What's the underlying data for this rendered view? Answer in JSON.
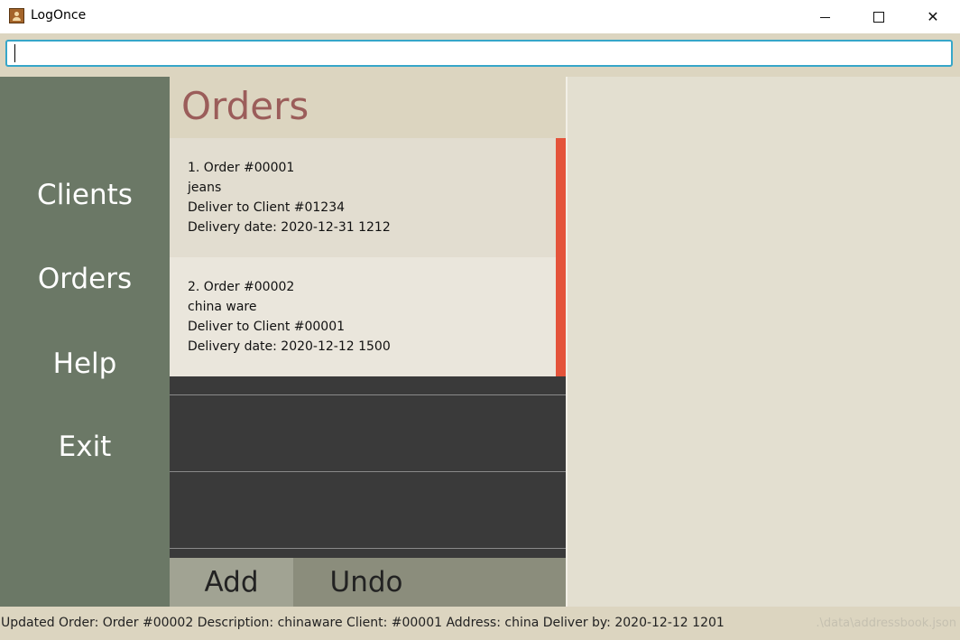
{
  "window": {
    "title": "LogOnce",
    "minimize_icon": "minimize-icon",
    "maximize_icon": "maximize-icon",
    "close_label": "✕"
  },
  "command": {
    "value": "",
    "placeholder": ""
  },
  "sidebar": {
    "items": [
      {
        "label": "Clients"
      },
      {
        "label": "Orders"
      },
      {
        "label": "Help"
      },
      {
        "label": "Exit"
      }
    ]
  },
  "orders": {
    "title": "Orders",
    "items": [
      {
        "heading": "1.  Order #00001",
        "description": "jeans",
        "client": "Deliver to Client #01234",
        "date": "Delivery date: 2020-12-31 1212"
      },
      {
        "heading": "2.  Order #00002",
        "description": "china ware",
        "client": "Deliver to Client #00001",
        "date": "Delivery date: 2020-12-12 1500"
      }
    ],
    "buttons": {
      "add": "Add",
      "undo": "Undo"
    }
  },
  "status": {
    "message": "Updated Order: Order #00002  Description: chinaware Client: #00001 Address: china Deliver by: 2020-12-12 1201",
    "path": ".\\data\\addressbook.json"
  },
  "colors": {
    "sidebar": "#6b7866",
    "accent_scrollbar": "#e4533a",
    "title_color": "#9b5d5a",
    "input_border": "#36a6c9"
  }
}
